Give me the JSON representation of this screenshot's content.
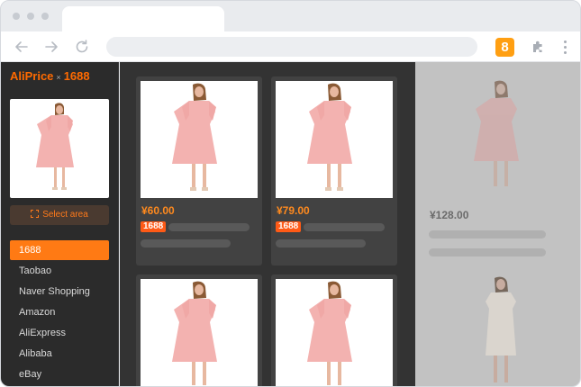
{
  "browser": {
    "extension_badge": "8",
    "icons": [
      "back-arrow-icon",
      "forward-arrow-icon",
      "reload-icon",
      "puzzle-icon",
      "kebab-menu-icon"
    ]
  },
  "sidebar": {
    "brand": {
      "name": "AliPrice",
      "separator": "×",
      "partner": "1688"
    },
    "select_area_label": "Select area",
    "platforms": [
      {
        "label": "1688",
        "active": true
      },
      {
        "label": "Taobao",
        "active": false
      },
      {
        "label": "Naver Shopping",
        "active": false
      },
      {
        "label": "Amazon",
        "active": false
      },
      {
        "label": "AliExpress",
        "active": false
      },
      {
        "label": "Alibaba",
        "active": false
      },
      {
        "label": "eBay",
        "active": false
      }
    ]
  },
  "results": [
    {
      "price": "¥60.00",
      "tag": "1688",
      "image": "pink-dress"
    },
    {
      "price": "¥79.00",
      "tag": "1688",
      "image": "pink-dress"
    },
    {
      "price": "",
      "tag": "",
      "image": "pink-dress"
    },
    {
      "price": "",
      "tag": "",
      "image": "pink-dress"
    }
  ],
  "preview": {
    "price": "¥128.00",
    "images": [
      "pink-dress",
      "beige-dress"
    ]
  },
  "colors": {
    "accent": "#ff7a14",
    "price": "#ff8a1e",
    "tag": "#ff5a16",
    "sidebar_bg": "#2b2b2b",
    "grid_bg": "#333333",
    "overlay_bg": "#c2c2c2"
  }
}
